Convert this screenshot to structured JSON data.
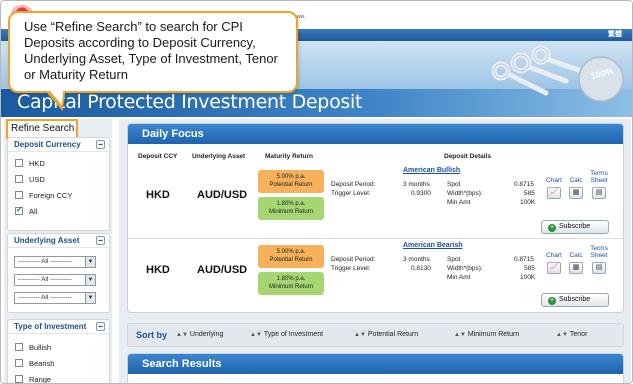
{
  "callout": {
    "text": "Use “Refine Search” to search for CPI Deposits according to Deposit Currency, Underlying Asset, Type of Investment, Tenor or Maturity Return"
  },
  "banner": {
    "title": "Capital Protected Investment Deposit",
    "top_right_label": "繁體"
  },
  "sidebar": {
    "title": "Refine Search",
    "deposit_currency": {
      "heading": "Deposit Currency",
      "options": [
        {
          "label": "HKD",
          "checked": false
        },
        {
          "label": "USD",
          "checked": false
        },
        {
          "label": "Foreign CCY",
          "checked": false
        },
        {
          "label": "All",
          "checked": true
        }
      ]
    },
    "underlying_asset": {
      "heading": "Underlying Asset",
      "selects": [
        "---------- All ----------",
        "---------- All ----------",
        "---------- All ----------"
      ]
    },
    "type_of_investment": {
      "heading": "Type of Investment",
      "options": [
        {
          "label": "Bullish",
          "checked": false
        },
        {
          "label": "Bearish",
          "checked": false
        },
        {
          "label": "Range",
          "checked": false
        }
      ]
    }
  },
  "daily_focus": {
    "heading": "Daily Focus",
    "columns": {
      "deposit_ccy": "Deposit CCY",
      "underlying_asset": "Underlying Asset",
      "maturity_return": "Maturity Return",
      "deposit_details": "Deposit Details"
    },
    "icon_labels": {
      "chart": "Chart",
      "calc": "Calc",
      "terms": "Terms",
      "sheet": "Sheet"
    },
    "subscribe_label": "Subscribe",
    "rows": [
      {
        "ccy": "HKD",
        "asset": "AUD/USD",
        "potential_rate": "5.00% p.a.",
        "potential_label": "Potential Return",
        "minimum_rate": "1.80% p.a.",
        "minimum_label": "Minimum Return",
        "product": "American Bullish",
        "deposit_period_label": "Deposit Period:",
        "deposit_period": "3 months",
        "trigger_label": "Trigger Level:",
        "trigger": "0.9300",
        "spot_label": "Spot",
        "spot": "0.8715",
        "width_label": "Width*(bps):",
        "width": "585",
        "min_amt_label": "Min Amt",
        "min_amt": "100K"
      },
      {
        "ccy": "HKD",
        "asset": "AUD/USD",
        "potential_rate": "5.00% p.a.",
        "potential_label": "Potential Return",
        "minimum_rate": "1.80% p.a.",
        "minimum_label": "Minimum Return",
        "product": "American Bearish",
        "deposit_period_label": "Deposit Period:",
        "deposit_period": "3 months",
        "trigger_label": "Trigger Level:",
        "trigger": "0.8130",
        "spot_label": "Spot",
        "spot": "0.8715",
        "width_label": "Width*(bps):",
        "width": "585",
        "min_amt_label": "Min Amt",
        "min_amt": "100K"
      }
    ]
  },
  "sort_bar": {
    "label": "Sort by",
    "items": [
      "Underlying",
      "Type of Investment",
      "Potential Return",
      "Minimum Return",
      "Tenor"
    ]
  },
  "search_results": {
    "heading": "Search Results"
  },
  "colors": {
    "accent_orange": "#f0a326",
    "header_blue": "#1f64ad",
    "potential_orange": "#f6b15a",
    "minimum_green": "#a6d672"
  }
}
